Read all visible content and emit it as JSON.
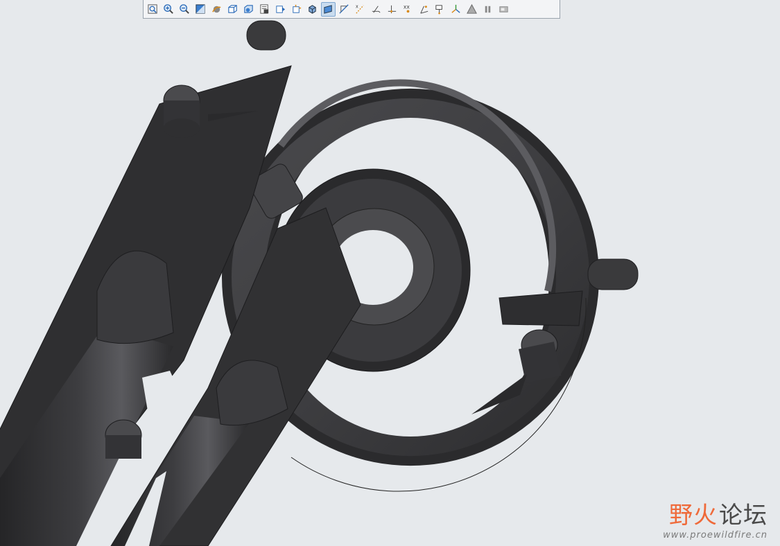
{
  "viewport": {
    "background": "#e6e9ec",
    "model_color": "#3b3b3d"
  },
  "toolbar": {
    "buttons": [
      {
        "icon": "refit-icon"
      },
      {
        "icon": "zoom-in-icon"
      },
      {
        "icon": "zoom-out-icon"
      },
      {
        "icon": "repaint-icon"
      },
      {
        "icon": "spin-center-icon"
      },
      {
        "icon": "view-orient-icon"
      },
      {
        "icon": "saved-views-icon"
      },
      {
        "icon": "layers-icon"
      },
      {
        "icon": "view-manager-icon"
      },
      {
        "icon": "perspective-icon"
      },
      {
        "icon": "display-style-icon"
      },
      {
        "icon": "shaded-edges-icon",
        "active": true
      },
      {
        "icon": "plane-display-icon"
      },
      {
        "icon": "axis-display-icon"
      },
      {
        "icon": "point-display-icon"
      },
      {
        "icon": "csys-display-icon"
      },
      {
        "icon": "point-tags-icon"
      },
      {
        "icon": "csys-tags-icon"
      },
      {
        "icon": "annotation-display-icon"
      },
      {
        "icon": "spin-center-display-icon"
      },
      {
        "icon": "simulation-icon"
      },
      {
        "icon": "pause-icon"
      },
      {
        "icon": "display-settings-icon"
      }
    ]
  },
  "watermark": {
    "title_a": "野火",
    "title_b": "论坛",
    "url": "www.proewildfire.cn",
    "color_accent": "#ef6a3a",
    "color_text": "#4a4a4a"
  }
}
